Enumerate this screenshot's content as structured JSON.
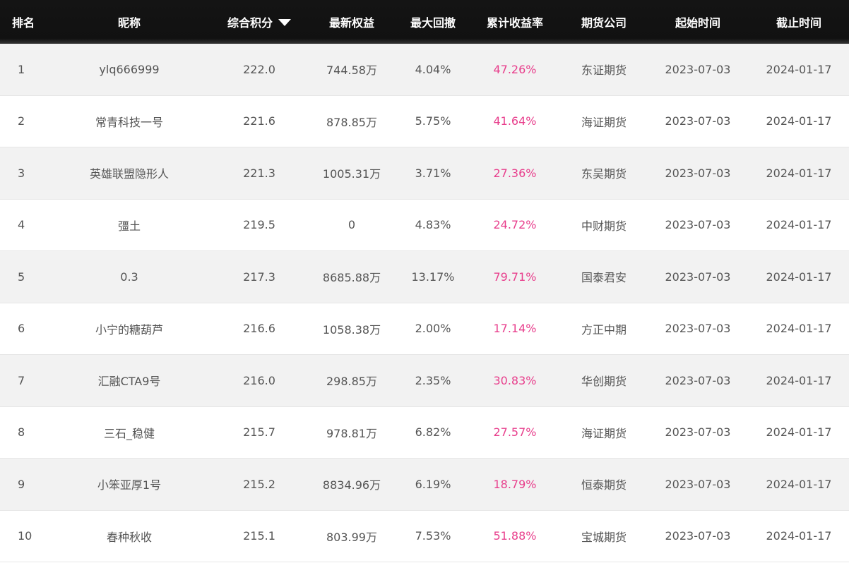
{
  "header": {
    "rank": "排名",
    "nickname": "昵称",
    "score": "综合积分",
    "equity": "最新权益",
    "drawdown": "最大回撤",
    "return": "累计收益率",
    "company": "期货公司",
    "start": "起始时间",
    "end": "截止时间"
  },
  "colors": {
    "header_bg": "#111111",
    "row_alt_bg": "#f2f2f2",
    "return_color": "#e83e8c",
    "text": "#555555"
  },
  "rows": [
    {
      "rank": "1",
      "nickname": "ylq666999",
      "score": "222.0",
      "equity": "744.58万",
      "drawdown": "4.04%",
      "return": "47.26%",
      "company": "东证期货",
      "start": "2023-07-03",
      "end": "2024-01-17"
    },
    {
      "rank": "2",
      "nickname": "常青科技一号",
      "score": "221.6",
      "equity": "878.85万",
      "drawdown": "5.75%",
      "return": "41.64%",
      "company": "海证期货",
      "start": "2023-07-03",
      "end": "2024-01-17"
    },
    {
      "rank": "3",
      "nickname": "英雄联盟隐形人",
      "score": "221.3",
      "equity": "1005.31万",
      "drawdown": "3.71%",
      "return": "27.36%",
      "company": "东吴期货",
      "start": "2023-07-03",
      "end": "2024-01-17"
    },
    {
      "rank": "4",
      "nickname": "彊土",
      "score": "219.5",
      "equity": "0",
      "drawdown": "4.83%",
      "return": "24.72%",
      "company": "中财期货",
      "start": "2023-07-03",
      "end": "2024-01-17"
    },
    {
      "rank": "5",
      "nickname": "0.3",
      "score": "217.3",
      "equity": "8685.88万",
      "drawdown": "13.17%",
      "return": "79.71%",
      "company": "国泰君安",
      "start": "2023-07-03",
      "end": "2024-01-17"
    },
    {
      "rank": "6",
      "nickname": "小宁的糖葫芦",
      "score": "216.6",
      "equity": "1058.38万",
      "drawdown": "2.00%",
      "return": "17.14%",
      "company": "方正中期",
      "start": "2023-07-03",
      "end": "2024-01-17"
    },
    {
      "rank": "7",
      "nickname": "汇融CTA9号",
      "score": "216.0",
      "equity": "298.85万",
      "drawdown": "2.35%",
      "return": "30.83%",
      "company": "华创期货",
      "start": "2023-07-03",
      "end": "2024-01-17"
    },
    {
      "rank": "8",
      "nickname": "三石_稳健",
      "score": "215.7",
      "equity": "978.81万",
      "drawdown": "6.82%",
      "return": "27.57%",
      "company": "海证期货",
      "start": "2023-07-03",
      "end": "2024-01-17"
    },
    {
      "rank": "9",
      "nickname": "小笨亚厚1号",
      "score": "215.2",
      "equity": "8834.96万",
      "drawdown": "6.19%",
      "return": "18.79%",
      "company": "恒泰期货",
      "start": "2023-07-03",
      "end": "2024-01-17"
    },
    {
      "rank": "10",
      "nickname": "春种秋收",
      "score": "215.1",
      "equity": "803.99万",
      "drawdown": "7.53%",
      "return": "51.88%",
      "company": "宝城期货",
      "start": "2023-07-03",
      "end": "2024-01-17"
    }
  ]
}
